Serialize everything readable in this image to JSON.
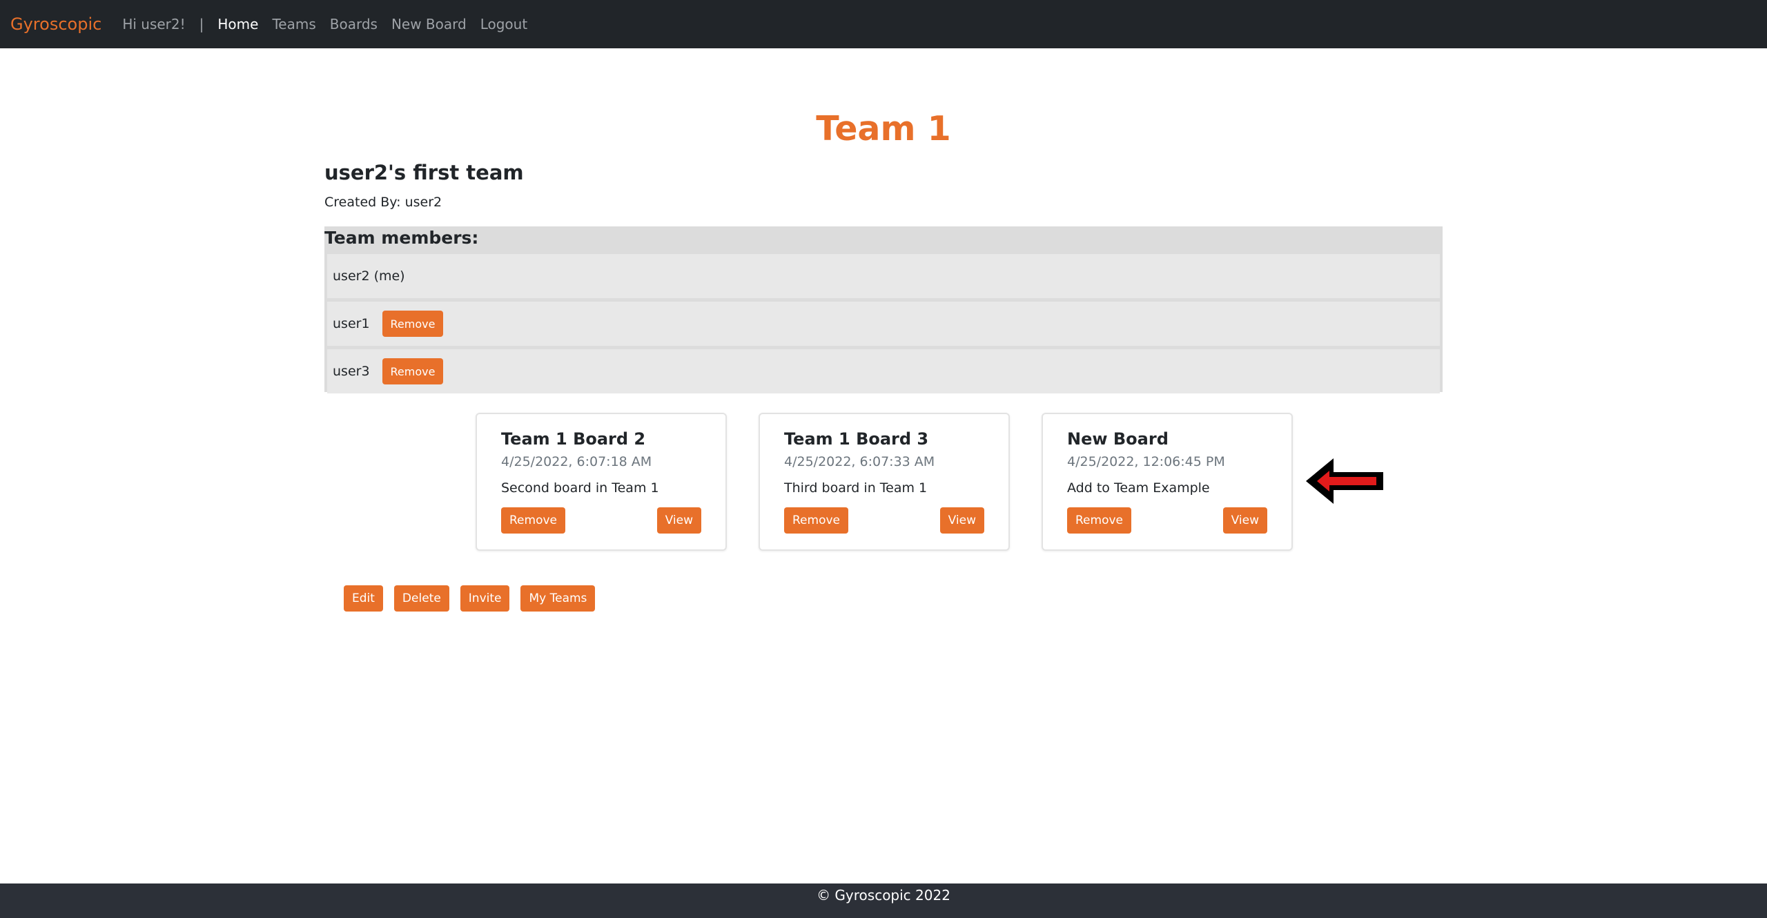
{
  "nav": {
    "brand": "Gyroscopic",
    "greeting": "Hi user2!",
    "separator": "|",
    "links": [
      "Home",
      "Teams",
      "Boards",
      "New Board",
      "Logout"
    ],
    "active": "Home"
  },
  "team": {
    "title": "Team 1",
    "description": "user2's first team",
    "created_by": "Created By: user2"
  },
  "members": {
    "heading": "Team members:",
    "list": [
      {
        "name": "user2 (me)",
        "removable": false
      },
      {
        "name": "user1",
        "removable": true,
        "button": "Remove"
      },
      {
        "name": "user3",
        "removable": true,
        "button": "Remove"
      }
    ]
  },
  "boards": [
    {
      "title": "Team 1 Board 2",
      "date": "4/25/2022, 6:07:18 AM",
      "description": "Second board in Team 1",
      "remove_label": "Remove",
      "view_label": "View"
    },
    {
      "title": "Team 1 Board 3",
      "date": "4/25/2022, 6:07:33 AM",
      "description": "Third board in Team 1",
      "remove_label": "Remove",
      "view_label": "View"
    },
    {
      "title": "New Board",
      "date": "4/25/2022, 12:06:45 PM",
      "description": "Add to Team Example",
      "remove_label": "Remove",
      "view_label": "View"
    }
  ],
  "actions": {
    "edit": "Edit",
    "delete": "Delete",
    "invite": "Invite",
    "my_teams": "My Teams"
  },
  "footer": {
    "text": "© Gyroscopic 2022"
  },
  "colors": {
    "accent": "#e8702a",
    "navbar": "#212529",
    "footer": "#2c3038",
    "arrow": "#e11b1b"
  },
  "annotation": {
    "icon": "arrow-left-icon"
  }
}
